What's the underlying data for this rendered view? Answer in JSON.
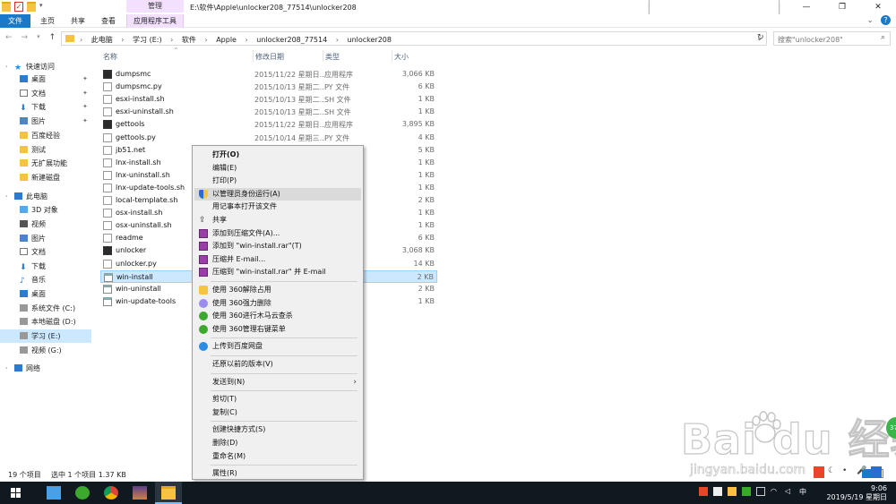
{
  "window": {
    "title": "E:\\软件\\Apple\\unlocker208_77514\\unlocker208",
    "context_group": "管理",
    "controls": [
      "—",
      "❐",
      "✕"
    ]
  },
  "ribbon": {
    "tabs": [
      "文件",
      "主页",
      "共享",
      "查看",
      "应用程序工具"
    ],
    "help": "?"
  },
  "address": {
    "crumbs": [
      "此电脑",
      "学习 (E:)",
      "软件",
      "Apple",
      "unlocker208_77514",
      "unlocker208"
    ],
    "search_placeholder": "搜索\"unlocker208\""
  },
  "nav": {
    "quick_access": "快速访问",
    "items": [
      {
        "label": "桌面",
        "pinned": true
      },
      {
        "label": "文档",
        "pinned": true
      },
      {
        "label": "下载",
        "pinned": true
      },
      {
        "label": "图片",
        "pinned": true
      },
      {
        "label": "百度经验"
      },
      {
        "label": "测试"
      },
      {
        "label": "无扩展功能"
      },
      {
        "label": "新建磁盘"
      }
    ],
    "this_pc": "此电脑",
    "pc_items": [
      "3D 对象",
      "视频",
      "图片",
      "文档",
      "下载",
      "音乐",
      "桌面",
      "系统文件 (C:)",
      "本地磁盘 (D:)",
      "学习 (E:)",
      "视频 (G:)"
    ],
    "network": "网络"
  },
  "columns": {
    "name": "名称",
    "date": "修改日期",
    "type": "类型",
    "size": "大小"
  },
  "files": [
    {
      "name": "dumpsmc",
      "date": "2015/11/22 星期日...",
      "type": "应用程序",
      "size": "3,066 KB",
      "icon": "exe"
    },
    {
      "name": "dumpsmc.py",
      "date": "2015/10/13 星期二...",
      "type": "PY 文件",
      "size": "6 KB",
      "icon": "doc"
    },
    {
      "name": "esxi-install.sh",
      "date": "2015/10/13 星期二...",
      "type": "SH 文件",
      "size": "1 KB",
      "icon": "doc"
    },
    {
      "name": "esxi-uninstall.sh",
      "date": "2015/10/13 星期二...",
      "type": "SH 文件",
      "size": "1 KB",
      "icon": "doc"
    },
    {
      "name": "gettools",
      "date": "2015/11/22 星期日...",
      "type": "应用程序",
      "size": "3,895 KB",
      "icon": "exe"
    },
    {
      "name": "gettools.py",
      "date": "2015/10/14 星期三...",
      "type": "PY 文件",
      "size": "4 KB",
      "icon": "doc"
    },
    {
      "name": "jb51.net",
      "date": "",
      "type": "",
      "size": "5 KB",
      "icon": "doc"
    },
    {
      "name": "lnx-install.sh",
      "date": "",
      "type": "",
      "size": "1 KB",
      "icon": "doc"
    },
    {
      "name": "lnx-uninstall.sh",
      "date": "",
      "type": "",
      "size": "1 KB",
      "icon": "doc"
    },
    {
      "name": "lnx-update-tools.sh",
      "date": "",
      "type": "",
      "size": "1 KB",
      "icon": "doc"
    },
    {
      "name": "local-template.sh",
      "date": "",
      "type": "",
      "size": "2 KB",
      "icon": "doc"
    },
    {
      "name": "osx-install.sh",
      "date": "",
      "type": "",
      "size": "1 KB",
      "icon": "doc"
    },
    {
      "name": "osx-uninstall.sh",
      "date": "",
      "type": "",
      "size": "1 KB",
      "icon": "doc"
    },
    {
      "name": "readme",
      "date": "",
      "type": "",
      "size": "6 KB",
      "icon": "doc"
    },
    {
      "name": "unlocker",
      "date": "",
      "type": "",
      "size": "3,068 KB",
      "icon": "exe"
    },
    {
      "name": "unlocker.py",
      "date": "",
      "type": "",
      "size": "14 KB",
      "icon": "doc"
    },
    {
      "name": "win-install",
      "date": "",
      "type": "命令脚本",
      "size": "2 KB",
      "icon": "bat",
      "selected": true
    },
    {
      "name": "win-uninstall",
      "date": "",
      "type": "命令脚本",
      "size": "2 KB",
      "icon": "bat"
    },
    {
      "name": "win-update-tools",
      "date": "",
      "type": "命令脚本",
      "size": "1 KB",
      "icon": "bat"
    }
  ],
  "status": {
    "count": "19 个项目",
    "selection": "选中 1 个项目  1.37 KB"
  },
  "context_menu": [
    {
      "label": "打开(O)",
      "bold": true
    },
    {
      "label": "编辑(E)"
    },
    {
      "label": "打印(P)"
    },
    {
      "label": "以管理员身份运行(A)",
      "icon": "shield",
      "highlight": true
    },
    {
      "label": "用记事本打开该文件"
    },
    {
      "label": "共享",
      "icon": "share"
    },
    {
      "label": "添加到压缩文件(A)...",
      "icon": "rar"
    },
    {
      "label": "添加到 \"win-install.rar\"(T)",
      "icon": "rar"
    },
    {
      "label": "压缩并 E-mail...",
      "icon": "rar"
    },
    {
      "label": "压缩到 \"win-install.rar\" 并 E-mail",
      "icon": "rar"
    },
    {
      "sep": true
    },
    {
      "label": "使用 360解除占用",
      "icon": "360y"
    },
    {
      "label": "使用 360强力删除",
      "icon": "360p"
    },
    {
      "label": "使用 360进行木马云查杀",
      "icon": "360g"
    },
    {
      "label": "使用 360管理右键菜单",
      "icon": "360g"
    },
    {
      "sep": true
    },
    {
      "label": "上传到百度网盘",
      "icon": "baidu"
    },
    {
      "sep": true
    },
    {
      "label": "还原以前的版本(V)"
    },
    {
      "sep": true
    },
    {
      "label": "发送到(N)",
      "submenu": true
    },
    {
      "sep": true
    },
    {
      "label": "剪切(T)"
    },
    {
      "label": "复制(C)"
    },
    {
      "sep": true
    },
    {
      "label": "创建快捷方式(S)"
    },
    {
      "label": "删除(D)"
    },
    {
      "label": "重命名(M)"
    },
    {
      "sep": true
    },
    {
      "label": "属性(R)"
    }
  ],
  "taskbar": {
    "time": "9:06",
    "date": "2019/5/19 星期日",
    "ime": "中"
  },
  "watermark": {
    "brand": "Bai  du 经验",
    "url": "jingyan.baidu.com"
  },
  "badge": "37"
}
